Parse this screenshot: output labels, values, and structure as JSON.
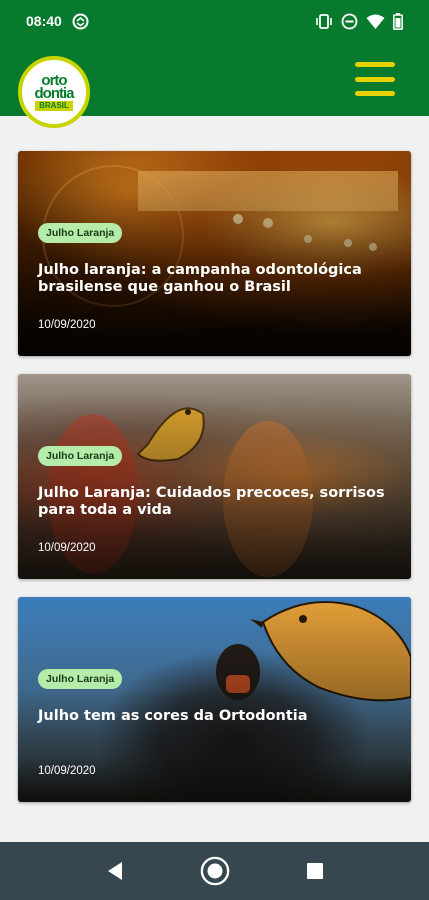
{
  "status_bar": {
    "time": "08:40",
    "left_icon": "sync-icon",
    "right_icons": [
      "vibrate-icon",
      "do-not-disturb-icon",
      "wifi-icon",
      "battery-icon"
    ]
  },
  "app_bar": {
    "logo": {
      "line1": "orto",
      "line2": "dontia",
      "line3": "BRASIL"
    },
    "menu_icon": "hamburger-menu-icon",
    "colors": {
      "primary": "#087a2e",
      "accent": "#e8d100"
    }
  },
  "articles": [
    {
      "tag": "Julho Laranja",
      "title": "Julho laranja: a campanha odontológica brasilense que ganhou o Brasil",
      "date": "10/09/2020"
    },
    {
      "tag": "Julho Laranja",
      "title": "Julho Laranja: Cuidados precoces, sorrisos para toda a vida",
      "date": "10/09/2020"
    },
    {
      "tag": "Julho Laranja",
      "title": "Julho tem as cores da Ortodontia",
      "date": "10/09/2020"
    }
  ],
  "nav_bar": {
    "buttons": [
      "back-icon",
      "home-icon",
      "recents-icon"
    ]
  }
}
